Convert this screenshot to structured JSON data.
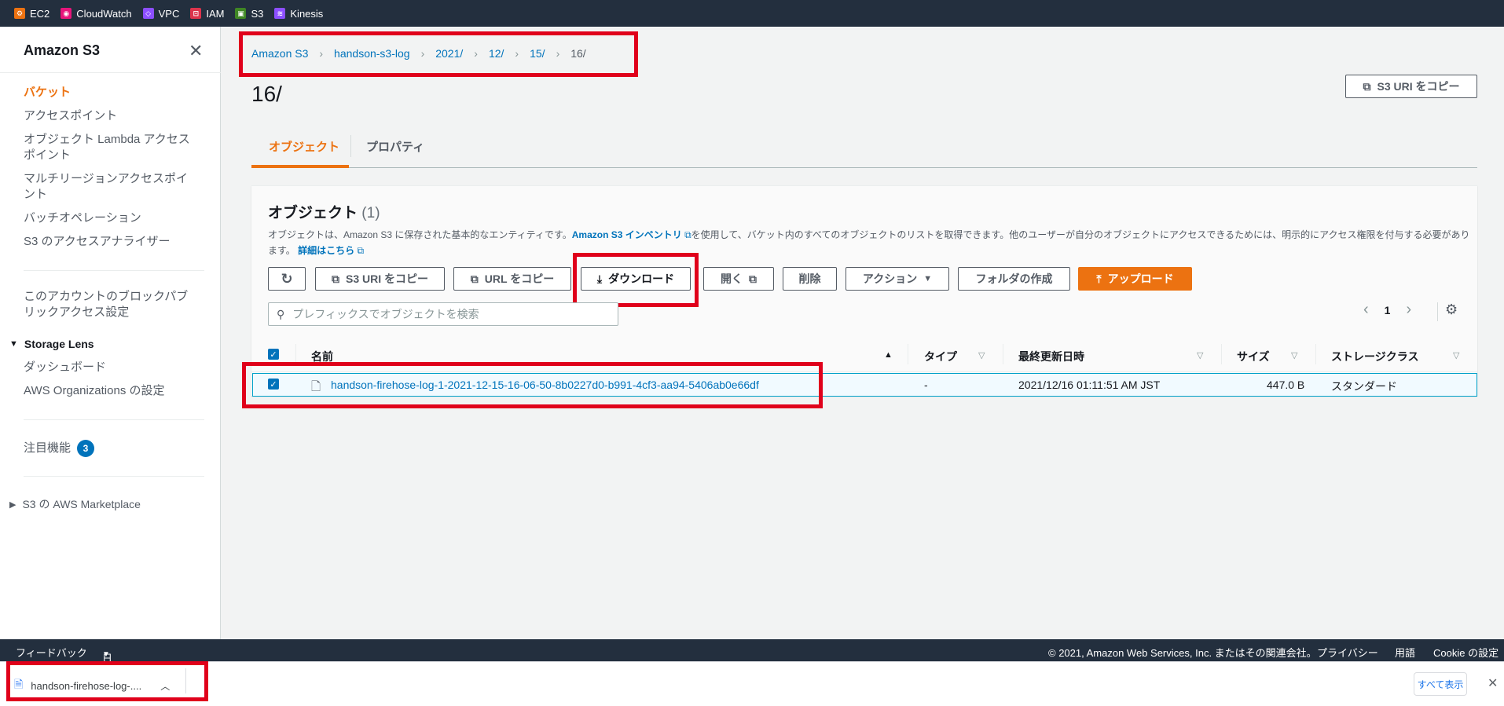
{
  "favorites": [
    {
      "label": "EC2",
      "color": "#ec7211"
    },
    {
      "label": "CloudWatch",
      "color": "#e7157b"
    },
    {
      "label": "VPC",
      "color": "#8c4fff"
    },
    {
      "label": "IAM",
      "color": "#dd344c"
    },
    {
      "label": "S3",
      "color": "#3f8624"
    },
    {
      "label": "Kinesis",
      "color": "#8c4fff"
    }
  ],
  "sidebar": {
    "title": "Amazon S3",
    "items": [
      "バケット",
      "アクセスポイント",
      "オブジェクト Lambda アクセスポイント",
      "マルチリージョンアクセスポイント",
      "バッチオペレーション",
      "S3 のアクセスアナライザー"
    ],
    "block_access": "このアカウントのブロックパブリックアクセス設定",
    "storage_lens": {
      "title": "Storage Lens",
      "items": [
        "ダッシュボード",
        "AWS Organizations の設定"
      ]
    },
    "featured": {
      "label": "注目機能",
      "count": "3"
    },
    "marketplace": "S3 の AWS Marketplace"
  },
  "breadcrumb": [
    "Amazon S3",
    "handson-s3-log",
    "2021/",
    "12/",
    "15/",
    "16/"
  ],
  "page_title": "16/",
  "copy_uri_top": "S3 URI をコピー",
  "tabs": [
    "オブジェクト",
    "プロパティ"
  ],
  "objects": {
    "title": "オブジェクト",
    "count": "(1)",
    "desc_1": "オブジェクトは、Amazon S3 に保存された基本的なエンティティです。",
    "desc_link": "Amazon S3 インベントリ",
    "desc_2": "を使用して、バケット内のすべてのオブジェクトのリストを取得できます。他のユーザーが自分のオブジェクトにアクセスできるためには、明示的にアクセス権限を付与する必要があります。",
    "desc_more": "詳細はこちら",
    "toolbar": {
      "copy_uri": "S3 URI をコピー",
      "copy_url": "URL をコピー",
      "download": "ダウンロード",
      "open": "開く",
      "delete": "削除",
      "actions": "アクション",
      "create_folder": "フォルダの作成",
      "upload": "アップロード"
    },
    "search_placeholder": "プレフィックスでオブジェクトを検索",
    "page": "1",
    "columns": [
      "名前",
      "タイプ",
      "最終更新日時",
      "サイズ",
      "ストレージクラス"
    ],
    "rows": [
      {
        "name": "handson-firehose-log-1-2021-12-15-16-06-50-8b0227d0-b991-4cf3-aa94-5406ab0e66df",
        "type": "-",
        "modified": "2021/12/16 01:11:51 AM JST",
        "size": "447.0 B",
        "storage": "スタンダード"
      }
    ]
  },
  "footer": {
    "feedback": "フィードバック",
    "language": "日本語",
    "copyright": "© 2021, Amazon Web Services, Inc. またはその関連会社。",
    "privacy": "プライバシー",
    "terms": "用語",
    "cookie": "Cookie の設定"
  },
  "download_bar": {
    "file": "handson-firehose-log-....",
    "show_all": "すべて表示"
  }
}
